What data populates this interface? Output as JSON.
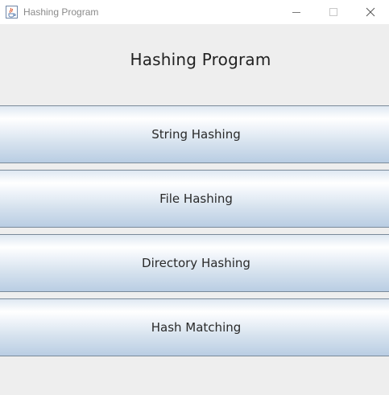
{
  "window": {
    "title": "Hashing Program",
    "icon": "java-cup-icon",
    "controls": [
      "minimize-icon",
      "maximize-icon",
      "close-icon"
    ]
  },
  "main": {
    "heading": "Hashing Program",
    "buttons": [
      {
        "label": "String Hashing"
      },
      {
        "label": "File Hashing"
      },
      {
        "label": "Directory Hashing"
      },
      {
        "label": "Hash Matching"
      }
    ]
  },
  "colors": {
    "background": "#eeeeee",
    "button_border": "#7a8a9a",
    "button_gradient_bottom": "#b9cde3"
  }
}
